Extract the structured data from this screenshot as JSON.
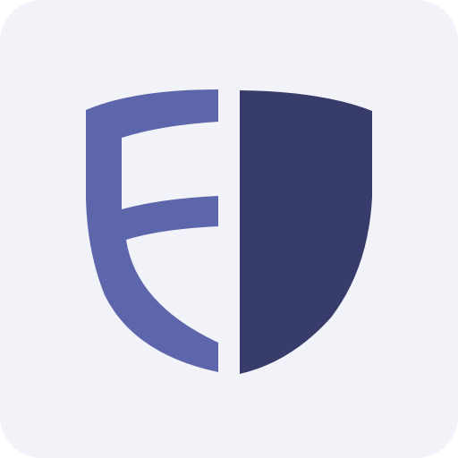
{
  "icon": {
    "name": "shield-logo-icon",
    "colors": {
      "background": "#f2f2f9",
      "left_half": "#5d66aa",
      "right_half": "#373c6a"
    }
  }
}
